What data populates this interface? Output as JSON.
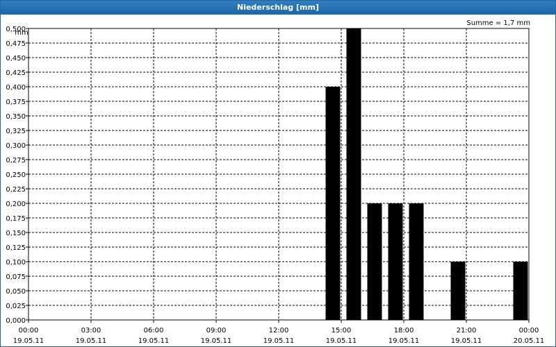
{
  "window": {
    "title": "Niederschlag [mm]"
  },
  "summary": {
    "text": "Summe = 1,7 mm"
  },
  "chart_data": {
    "type": "bar",
    "title": "Niederschlag [mm]",
    "ylabel": "mm",
    "ylim": [
      0,
      0.5
    ],
    "y_ticks": [
      "0,000",
      "0,025",
      "0,050",
      "0,075",
      "0,100",
      "0,125",
      "0,150",
      "0,175",
      "0,200",
      "0,225",
      "0,250",
      "0,275",
      "0,300",
      "0,325",
      "0,350",
      "0,375",
      "0,400",
      "0,425",
      "0,450",
      "0,475",
      "0,500"
    ],
    "x_range": [
      "2011-05-19 00:00",
      "2011-05-20 00:00"
    ],
    "x_ticks": [
      {
        "time": "00:00",
        "date": "19.05.11"
      },
      {
        "time": "03:00",
        "date": "19.05.11"
      },
      {
        "time": "06:00",
        "date": "19.05.11"
      },
      {
        "time": "09:00",
        "date": "19.05.11"
      },
      {
        "time": "12:00",
        "date": "19.05.11"
      },
      {
        "time": "15:00",
        "date": "19.05.11"
      },
      {
        "time": "18:00",
        "date": "19.05.11"
      },
      {
        "time": "21:00",
        "date": "19.05.11"
      },
      {
        "time": "00:00",
        "date": "20.05.11"
      }
    ],
    "bars": [
      {
        "time": "2011-05-19 14:00",
        "value": 0.4
      },
      {
        "time": "2011-05-19 15:00",
        "value": 0.5
      },
      {
        "time": "2011-05-19 16:00",
        "value": 0.2
      },
      {
        "time": "2011-05-19 17:00",
        "value": 0.2
      },
      {
        "time": "2011-05-19 18:00",
        "value": 0.2
      },
      {
        "time": "2011-05-19 20:00",
        "value": 0.1
      },
      {
        "time": "2011-05-19 23:00",
        "value": 0.1
      }
    ],
    "bar_color": "#000000",
    "grid": true
  }
}
